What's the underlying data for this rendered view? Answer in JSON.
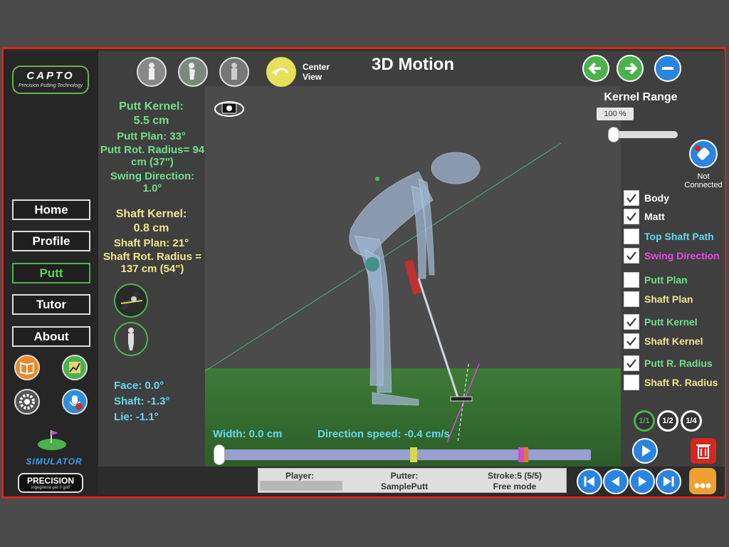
{
  "app": {
    "logo_text": "CAPTO",
    "logo_sub": "Precision Putting Technology",
    "title": "3D Motion"
  },
  "nav": {
    "home": "Home",
    "profile": "Profile",
    "putt": "Putt",
    "tutor": "Tutor",
    "about": "About"
  },
  "brand": {
    "simulator": "SIMULATOR",
    "precision": "PRECISION",
    "precision_sub": "ingegneria per il golf"
  },
  "view": {
    "center_view": "Center\nView"
  },
  "putt_stats": {
    "kernel_label": "Putt Kernel:",
    "kernel_value": "5.5 cm",
    "plan": "Putt Plan: 33°",
    "rot_radius": "Putt Rot. Radius= 94 cm  (37\")",
    "swing_direction": "Swing Direction: 1.0°"
  },
  "shaft_stats": {
    "kernel_label": "Shaft Kernel:",
    "kernel_value": "0.8 cm",
    "plan": "Shaft Plan: 21°",
    "rot_radius": "Shaft Rot. Radius = 137 cm  (54\")"
  },
  "angles": {
    "face": "Face: 0.0°",
    "shaft": "Shaft: -1.3°",
    "lie": "Lie: -1.1°"
  },
  "kernel_range": {
    "label": "Kernel Range",
    "value": "100 %",
    "level": 0
  },
  "connection": {
    "status": "Not Connected"
  },
  "layers": [
    {
      "label": "Body",
      "checked": true,
      "color": "#ffffff"
    },
    {
      "label": "Matt",
      "checked": true,
      "color": "#ffffff"
    },
    {
      "label": "Top Shaft Path",
      "checked": false,
      "color": "#65d8f0"
    },
    {
      "label": "Swing Direction",
      "checked": true,
      "color": "#e64ce6"
    },
    {
      "label": "Putt Plan",
      "checked": false,
      "color": "#6fe08a"
    },
    {
      "label": "Shaft Plan",
      "checked": false,
      "color": "#f2e68c"
    },
    {
      "label": "Putt Kernel",
      "checked": true,
      "color": "#6fe08a"
    },
    {
      "label": "Shaft Kernel",
      "checked": true,
      "color": "#f2e68c"
    },
    {
      "label": "Putt R. Radius",
      "checked": true,
      "color": "#6fe08a"
    },
    {
      "label": "Shaft R. Radius",
      "checked": false,
      "color": "#f2e68c"
    }
  ],
  "overlay": {
    "width": "Width: 0.0 cm",
    "direction_speed": "Direction speed: -0.4 cm/s"
  },
  "speed": {
    "full": "1/1",
    "half": "1/2",
    "quarter": "1/4"
  },
  "footer": {
    "player_label": "Player:",
    "player_value": "",
    "putter_label": "Putter:",
    "putter_value": "SamplePutt",
    "stroke": "Stroke:5 (5/5)",
    "mode": "Free mode"
  },
  "colors": {
    "frame": "#d8261c",
    "accent_green": "#6fe08a",
    "accent_yellow": "#f2e68c"
  }
}
